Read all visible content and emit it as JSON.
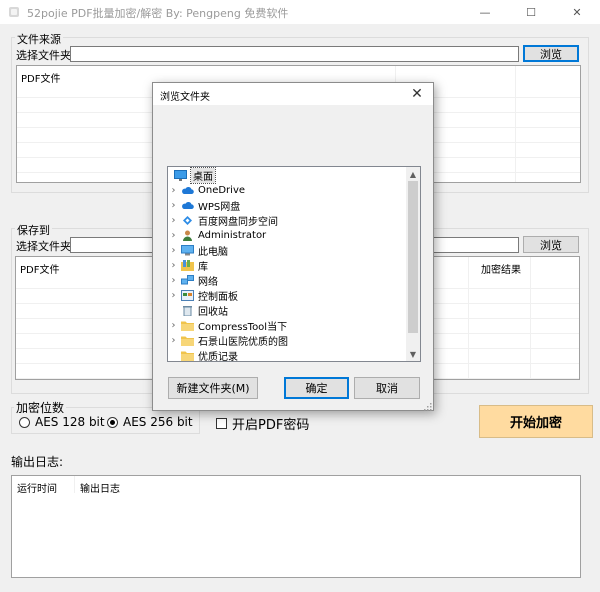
{
  "window": {
    "title": "52pojie  PDF批量加密/解密  By: Pengpeng  免费软件",
    "minimize_glyph": "—",
    "maximize_glyph": "☐",
    "close_glyph": "✕"
  },
  "source_group": {
    "legend": "文件来源",
    "folder_label": "选择文件夹",
    "folder_value": "",
    "browse_label": "浏览",
    "list_header": "PDF文件"
  },
  "output_group": {
    "legend": "保存到",
    "folder_label": "选择文件夹",
    "folder_value": "",
    "browse_label": "浏览",
    "list_header": "PDF文件",
    "result_header": "加密结果"
  },
  "encryption": {
    "legend": "加密位数",
    "options": [
      "AES 128 bit",
      "AES 256 bit"
    ],
    "selected": "AES 256 bit",
    "pdf_password_label": "开启PDF密码",
    "pdf_password_checked": false,
    "start_label": "开始加密",
    "start_color": "#ffdba0"
  },
  "log": {
    "label": "输出日志:",
    "columns": [
      "运行时间",
      "输出日志"
    ]
  },
  "dialog": {
    "title": "浏览文件夹",
    "close_glyph": "✕",
    "tree": [
      {
        "label": "桌面",
        "icon": "desktop-icon",
        "chevron": false,
        "indent": 0,
        "selected": true
      },
      {
        "label": "OneDrive",
        "icon": "cloud-icon",
        "chevron": true,
        "indent": 1
      },
      {
        "label": "WPS网盘",
        "icon": "cloud-icon",
        "chevron": true,
        "indent": 1
      },
      {
        "label": "百度网盘同步空间",
        "icon": "baidu-icon",
        "chevron": true,
        "indent": 1
      },
      {
        "label": "Administrator",
        "icon": "user-icon",
        "chevron": true,
        "indent": 1
      },
      {
        "label": "此电脑",
        "icon": "computer-icon",
        "chevron": true,
        "indent": 1
      },
      {
        "label": "库",
        "icon": "library-icon",
        "chevron": true,
        "indent": 1
      },
      {
        "label": "网络",
        "icon": "network-icon",
        "chevron": true,
        "indent": 1
      },
      {
        "label": "控制面板",
        "icon": "control-panel-icon",
        "chevron": true,
        "indent": 1
      },
      {
        "label": "回收站",
        "icon": "recycle-bin-icon",
        "chevron": false,
        "indent": 1
      },
      {
        "label": "CompressTool当下",
        "icon": "folder-icon",
        "chevron": true,
        "indent": 1
      },
      {
        "label": "石景山医院优质的图",
        "icon": "folder-icon",
        "chevron": true,
        "indent": 1
      },
      {
        "label": "优质记录",
        "icon": "folder-icon",
        "chevron": false,
        "indent": 1
      }
    ],
    "new_folder_label": "新建文件夹(M)",
    "ok_label": "确定",
    "cancel_label": "取消"
  },
  "colors": {
    "accent": "#0078d7",
    "folder": "#f0c44c",
    "cloud": "#1e78d6",
    "start_button": "#ffdba0"
  }
}
